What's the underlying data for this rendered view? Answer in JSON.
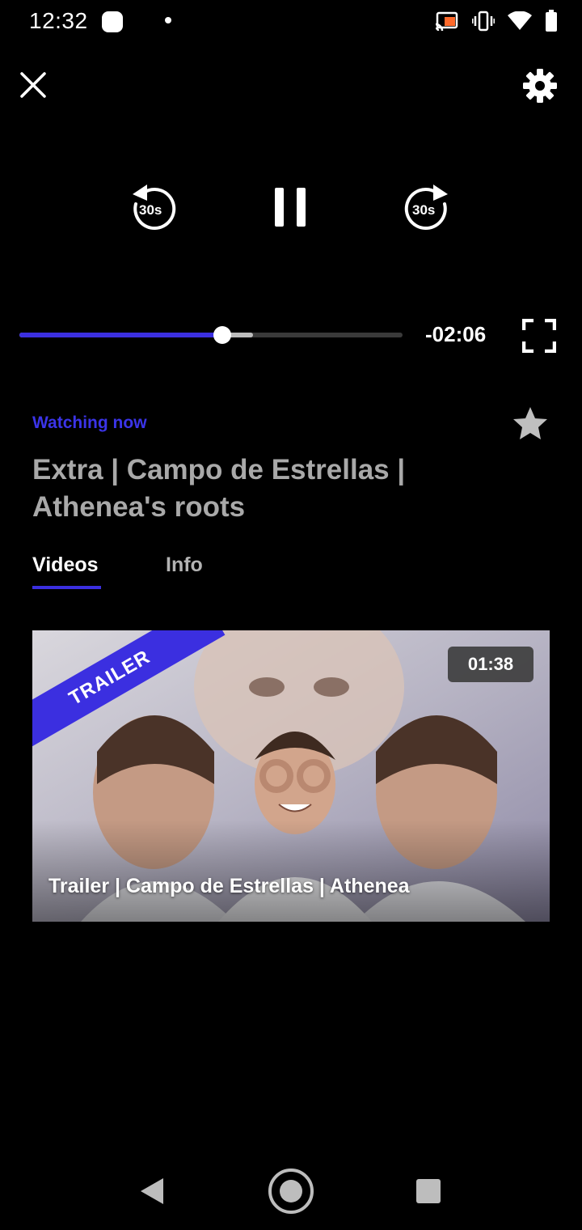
{
  "status_bar": {
    "time": "12:32",
    "icons": [
      "cast-icon",
      "vibrate-icon",
      "wifi-icon",
      "battery-icon"
    ]
  },
  "player": {
    "close_icon": "close-icon",
    "settings_icon": "gear-icon",
    "rewind_label": "30s",
    "forward_label": "30s",
    "remaining_time": "-02:06",
    "played_fraction": 0.53,
    "buffered_fraction": 0.61,
    "accent_color": "#3b2fe0"
  },
  "info": {
    "watching_label": "Watching now",
    "title": "Extra | Campo de Estrellas | Athenea's roots",
    "favorite_icon": "star-icon"
  },
  "tabs": [
    {
      "label": "Videos",
      "active": true
    },
    {
      "label": "Info",
      "active": false
    }
  ],
  "video_card": {
    "badge": "TRAILER",
    "duration": "01:38",
    "title": "Trailer | Campo de Estrellas | Athenea"
  },
  "nav_bar": {
    "icons": [
      "back-icon",
      "home-icon",
      "recents-icon"
    ]
  }
}
